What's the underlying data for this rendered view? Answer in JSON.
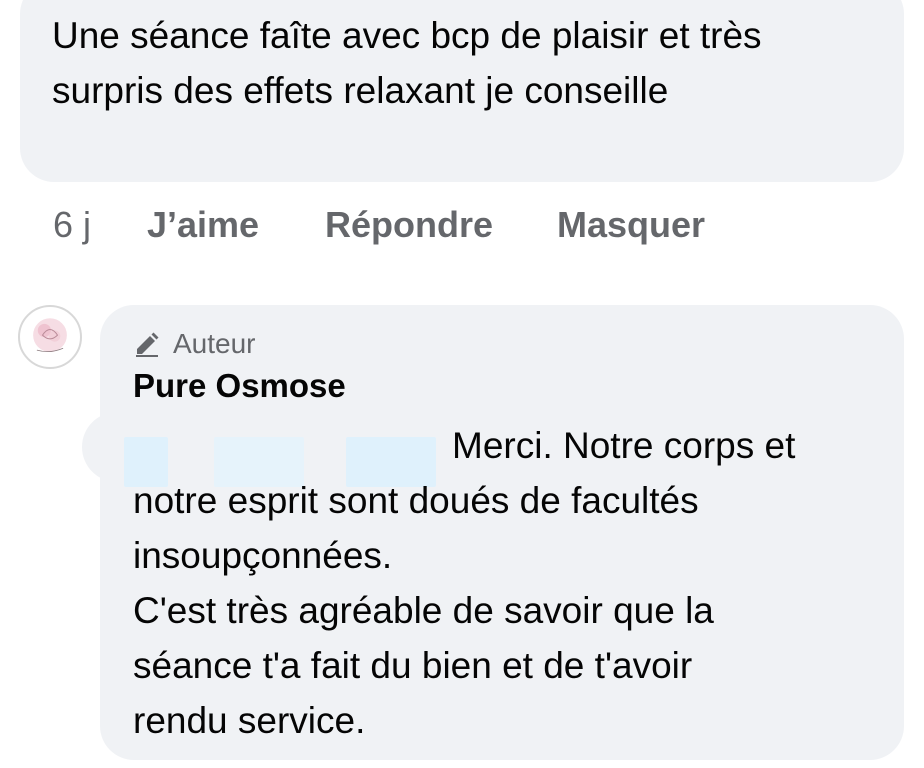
{
  "comment": {
    "text": "Une séance faîte avec bcp de plaisir et très surpris des effets relaxant je conseille"
  },
  "actions": {
    "time": "6 j",
    "like": "J’aime",
    "reply": "Répondre",
    "hide": "Masquer"
  },
  "reply": {
    "author_badge": "Auteur",
    "author_name": "Pure Osmose",
    "first_line": "Merci. Notre corps et",
    "lines": [
      "notre esprit sont doués de facultés",
      "insoupçonnées.",
      "C'est très agréable de savoir que la",
      "séance t'a fait du bien et de t'avoir",
      "rendu service."
    ]
  },
  "colors": {
    "bubble": "#f0f2f5",
    "secondary_text": "#65676b",
    "primary_text": "#050505"
  },
  "icons": {
    "author_badge_icon": "pencil-icon",
    "avatar": "pure-osmose-logo"
  }
}
